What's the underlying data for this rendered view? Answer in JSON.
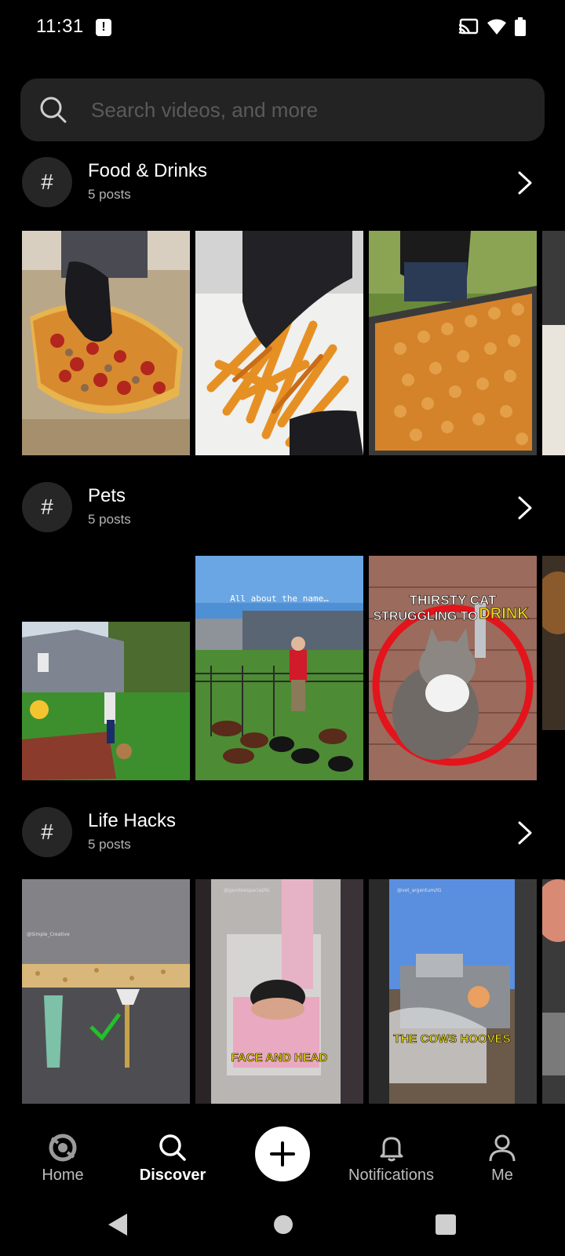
{
  "status_bar": {
    "time": "11:31"
  },
  "search": {
    "placeholder": "Search videos, and more"
  },
  "sections": [
    {
      "title": "Food & Drinks",
      "count": "5 posts"
    },
    {
      "title": "Pets",
      "count": "5 posts"
    },
    {
      "title": "Life Hacks",
      "count": "5 posts"
    }
  ],
  "thumb_captions": {
    "pets_1": "All about the name…",
    "pets_2_line1": "THIRSTY CAT",
    "pets_2_line2": "STRUGGLING TO",
    "pets_2_line2b": "DRINK",
    "hacks_0_tag": "@Simple_Creative",
    "hacks_1_tag": "@garotoespacial/IG",
    "hacks_1_caption": "FACE AND HEAD",
    "hacks_2_tag": "@vet_argentum/IG",
    "hacks_2_caption": "THE COWS HOOVES"
  },
  "bottom_nav": {
    "home": "Home",
    "discover": "Discover",
    "notifications": "Notifications",
    "me": "Me"
  }
}
